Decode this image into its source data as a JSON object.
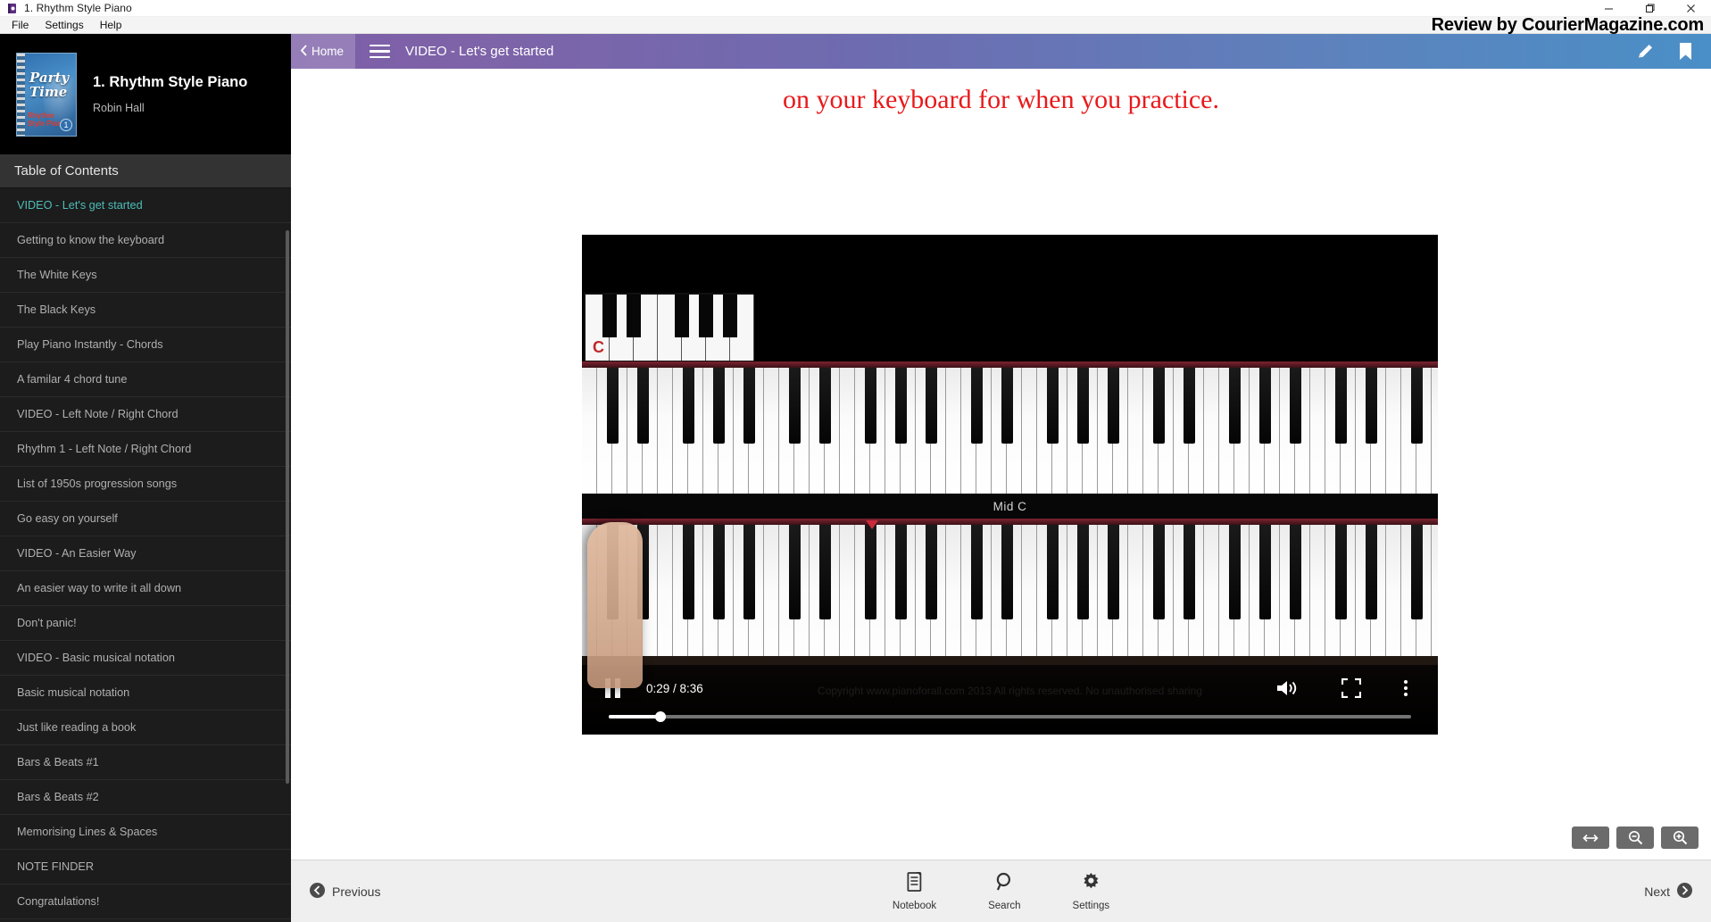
{
  "window": {
    "title": "1. Rhythm Style Piano",
    "app_icon": "book-icon",
    "minimize": "minimize-icon",
    "maximize": "maximize-icon",
    "close": "close-icon"
  },
  "menubar": {
    "items": [
      "File",
      "Settings",
      "Help"
    ],
    "watermark": "Review by CourierMagazine.com"
  },
  "sidebar": {
    "book": {
      "title": "1. Rhythm Style Piano",
      "author": "Robin Hall",
      "cover_line1": "Party",
      "cover_line2": "Time",
      "cover_subtitle": "Rhythm Style Piano",
      "cover_badge": "1"
    },
    "toc_header": "Table of Contents",
    "items": [
      {
        "label": "VIDEO - Let's get started",
        "active": true
      },
      {
        "label": "Getting to know the keyboard",
        "active": false
      },
      {
        "label": "The White Keys",
        "active": false
      },
      {
        "label": "The Black Keys",
        "active": false
      },
      {
        "label": "Play Piano Instantly - Chords",
        "active": false
      },
      {
        "label": "A familar 4 chord tune",
        "active": false
      },
      {
        "label": "VIDEO - Left Note / Right Chord",
        "active": false
      },
      {
        "label": "Rhythm 1 - Left Note / Right Chord",
        "active": false
      },
      {
        "label": "List of 1950s progression songs",
        "active": false
      },
      {
        "label": "Go easy on yourself",
        "active": false
      },
      {
        "label": "VIDEO - An Easier Way",
        "active": false
      },
      {
        "label": "An easier way to write it all down",
        "active": false
      },
      {
        "label": "Don't panic!",
        "active": false
      },
      {
        "label": "VIDEO - Basic musical notation",
        "active": false
      },
      {
        "label": "Basic musical notation",
        "active": false
      },
      {
        "label": "Just like reading a book",
        "active": false
      },
      {
        "label": "Bars & Beats #1",
        "active": false
      },
      {
        "label": "Bars & Beats #2",
        "active": false
      },
      {
        "label": "Memorising Lines & Spaces",
        "active": false
      },
      {
        "label": "NOTE FINDER",
        "active": false
      },
      {
        "label": "Congratulations!",
        "active": false
      }
    ]
  },
  "toolbar": {
    "home_label": "Home",
    "menu_icon": "hamburger-icon",
    "page_title": "VIDEO - Let's get started",
    "edit_icon": "pencil-icon",
    "bookmark_icon": "bookmark-icon",
    "gradient_start": "#7b5ea7",
    "gradient_end": "#4a8fc7"
  },
  "page": {
    "red_text": "on your keyboard for when you practice.",
    "red_color": "#e8191b"
  },
  "video": {
    "mini_keyboard_label": "C",
    "mid_c_label": "Mid C",
    "copyright": "Copyright www.pianoforall.com 2013  All rights reserved. No unauthorised sharing",
    "play_state": "pause-icon",
    "current_time": "0:29",
    "duration": "8:36",
    "time_display": "0:29 / 8:36",
    "progress_percent": 6.5,
    "volume_icon": "volume-icon",
    "fullscreen_icon": "fullscreen-icon",
    "more_icon": "kebab-menu-icon"
  },
  "zoom_controls": [
    {
      "name": "fit-width-icon"
    },
    {
      "name": "zoom-out-icon"
    },
    {
      "name": "zoom-in-icon"
    }
  ],
  "bottombar": {
    "previous": "Previous",
    "next": "Next",
    "actions": [
      {
        "label": "Notebook",
        "icon": "notebook-icon"
      },
      {
        "label": "Search",
        "icon": "search-icon"
      },
      {
        "label": "Settings",
        "icon": "gear-icon"
      }
    ]
  }
}
